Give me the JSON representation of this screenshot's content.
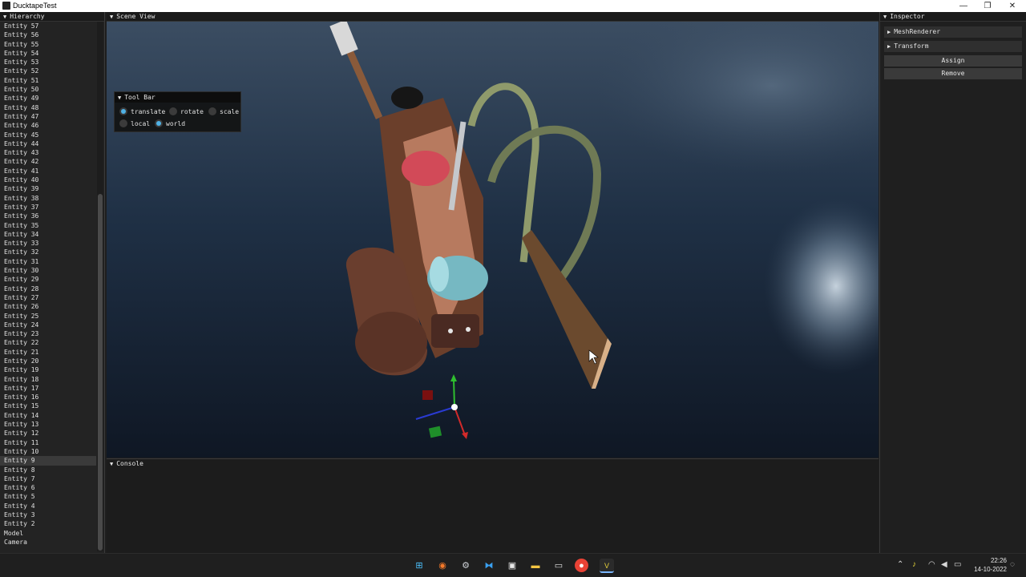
{
  "window": {
    "title": "DucktapeTest",
    "minimize": "—",
    "maximize": "❐",
    "close": "✕"
  },
  "hierarchy": {
    "title": "Hierarchy",
    "items": [
      "Entity 57",
      "Entity 56",
      "Entity 55",
      "Entity 54",
      "Entity 53",
      "Entity 52",
      "Entity 51",
      "Entity 50",
      "Entity 49",
      "Entity 48",
      "Entity 47",
      "Entity 46",
      "Entity 45",
      "Entity 44",
      "Entity 43",
      "Entity 42",
      "Entity 41",
      "Entity 40",
      "Entity 39",
      "Entity 38",
      "Entity 37",
      "Entity 36",
      "Entity 35",
      "Entity 34",
      "Entity 33",
      "Entity 32",
      "Entity 31",
      "Entity 30",
      "Entity 29",
      "Entity 28",
      "Entity 27",
      "Entity 26",
      "Entity 25",
      "Entity 24",
      "Entity 23",
      "Entity 22",
      "Entity 21",
      "Entity 20",
      "Entity 19",
      "Entity 18",
      "Entity 17",
      "Entity 16",
      "Entity 15",
      "Entity 14",
      "Entity 13",
      "Entity 12",
      "Entity 11",
      "Entity 10",
      "Entity 9",
      "Entity 8",
      "Entity 7",
      "Entity 6",
      "Entity 5",
      "Entity 4",
      "Entity 3",
      "Entity 2",
      "Model",
      "Camera"
    ],
    "selected": "Entity 9"
  },
  "scene": {
    "title": "Scene View"
  },
  "toolbar": {
    "title": "Tool Bar",
    "translate": "translate",
    "rotate": "rotate",
    "scale": "scale",
    "local": "local",
    "world": "world",
    "active_operation": "translate",
    "active_space": "world"
  },
  "console": {
    "title": "Console"
  },
  "inspector": {
    "title": "Inspector",
    "components": [
      "MeshRenderer",
      "Transform"
    ],
    "assign": "Assign",
    "remove": "Remove"
  },
  "taskbar": {
    "icons": [
      "windows-start-icon",
      "blender-icon",
      "settings-icon",
      "vscode-icon",
      "paint-icon",
      "file-explorer-icon",
      "terminal-icon",
      "chrome-icon",
      "ducktape-app-icon"
    ],
    "time": "22:26",
    "date": "14-10-2022"
  },
  "colors": {
    "accent": "#4fb2e6",
    "water": "#1a2a3c",
    "gizmo_x": "#d22a2a",
    "gizmo_y": "#2fbf2f",
    "gizmo_z": "#2a3bd2"
  }
}
